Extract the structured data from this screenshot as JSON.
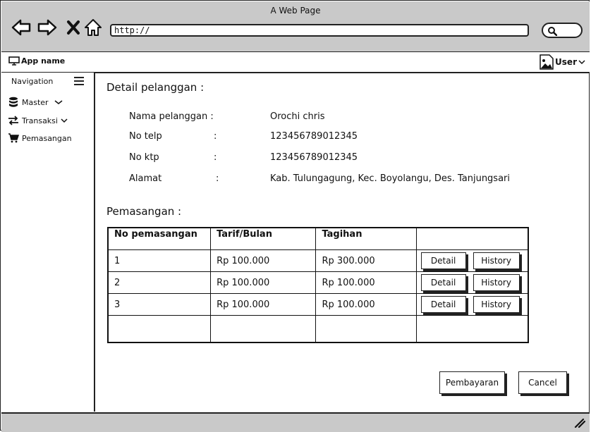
{
  "browser": {
    "window_title": "A Web Page",
    "url": "http://"
  },
  "appbar": {
    "app_name": "App name",
    "user_label": "User"
  },
  "sidebar": {
    "title": "Navigation",
    "items": [
      {
        "label": "Master",
        "icon": "database-icon"
      },
      {
        "label": "Transaksi",
        "icon": "transfer-icon"
      },
      {
        "label": "Pemasangan",
        "icon": "cart-icon"
      }
    ]
  },
  "detail": {
    "heading": "Detail pelanggan :",
    "fields": [
      {
        "label": "Nama pelanggan :",
        "colon": "",
        "value": "Orochi chris"
      },
      {
        "label": "No telp",
        "colon": ":",
        "value": "123456789012345"
      },
      {
        "label": "No ktp",
        "colon": ":",
        "value": "123456789012345"
      },
      {
        "label": "Alamat",
        "colon": ":",
        "value": "Kab. Tulungagung, Kec. Boyolangu, Des. Tanjungsari"
      }
    ]
  },
  "pemasangan": {
    "heading": "Pemasangan :",
    "columns": [
      "No pemasangan",
      "Tarif/Bulan",
      "Tagihan",
      ""
    ],
    "rows": [
      {
        "no": "1",
        "tarif": "Rp 100.000",
        "tagihan": "Rp 300.000"
      },
      {
        "no": "2",
        "tarif": "Rp 100.000",
        "tagihan": "Rp 100.000"
      },
      {
        "no": "3",
        "tarif": "Rp 100.000",
        "tagihan": "Rp 100.000"
      }
    ],
    "detail_label": "Detail",
    "history_label": "History"
  },
  "actions": {
    "pay_label": "Pembayaran",
    "cancel_label": "Cancel"
  }
}
